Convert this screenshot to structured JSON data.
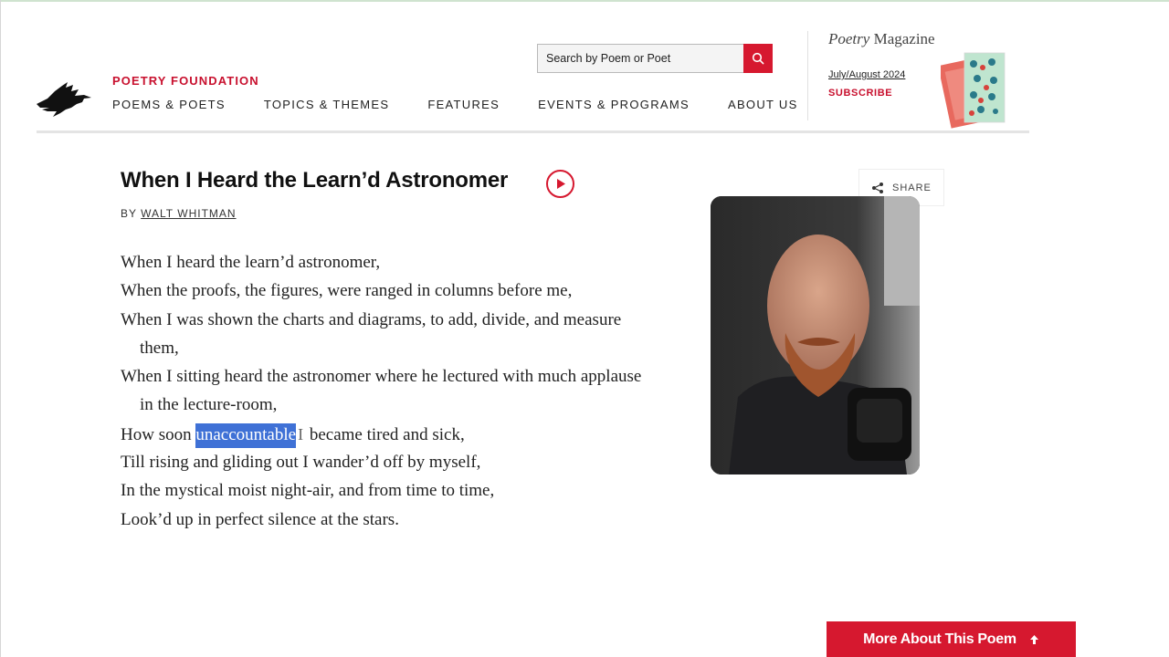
{
  "header": {
    "brand": "POETRY FOUNDATION",
    "nav": [
      "POEMS & POETS",
      "TOPICS & THEMES",
      "FEATURES",
      "EVENTS & PROGRAMS",
      "ABOUT US"
    ],
    "search_placeholder": "Search by Poem or Poet",
    "search_icon": "search-icon",
    "magazine": {
      "title_italic": "Poetry",
      "title_rest": " Magazine",
      "issue": "July/August 2024",
      "subscribe": "SUBSCRIBE"
    }
  },
  "poem": {
    "title": "When I Heard the Learn’d Astronomer",
    "by_prefix": "BY ",
    "author": "WALT WHITMAN",
    "lines": [
      "When I heard the learn’d astronomer,",
      "When the proofs, the figures, were ranged in columns before me,",
      "When I was shown the charts and diagrams, to add, divide, and measure",
      "them,",
      "When I sitting heard the astronomer where he lectured with much applause",
      "in the lecture-room,",
      "How soon ",
      "unaccountable",
      " became tired and sick,",
      "Till rising and gliding out I wander’d off by myself,",
      "In the mystical moist night-air, and from time to time,",
      "Look’d up in perfect silence at the stars."
    ],
    "cursor_glyph": "I"
  },
  "share_label": "SHARE",
  "more_button": "More About This Poem",
  "colors": {
    "brand_red": "#c8102e",
    "button_red": "#d6182f",
    "highlight": "#3f71d6"
  }
}
